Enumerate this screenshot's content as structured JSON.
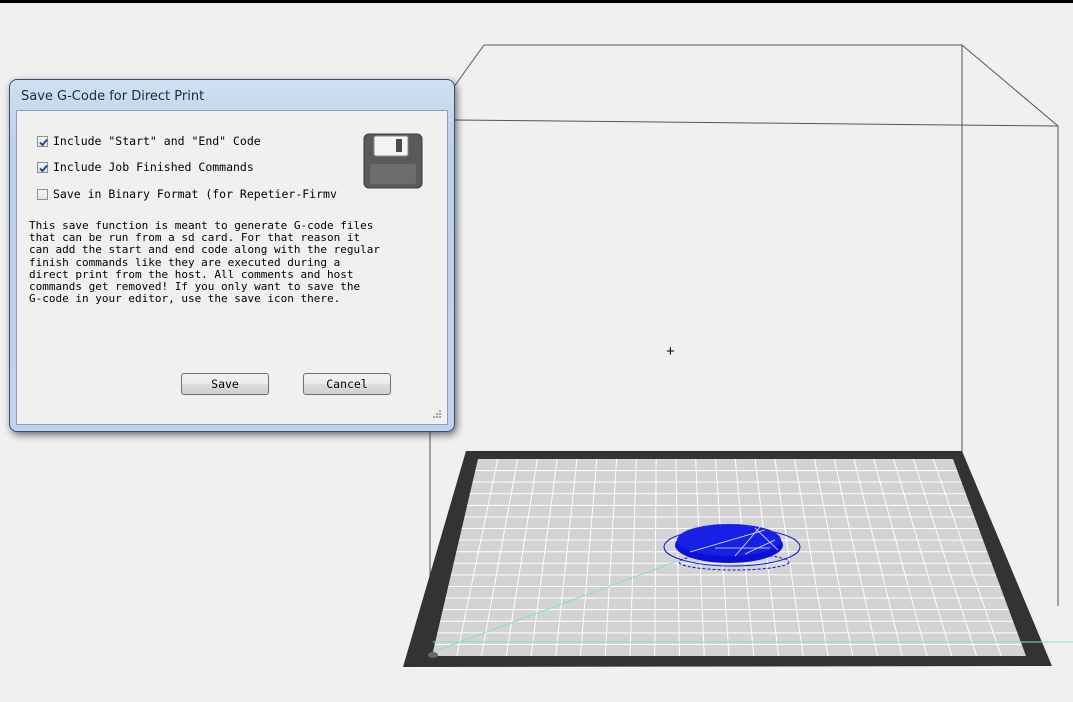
{
  "dialog": {
    "title": "Save G-Code for Direct Print",
    "options": [
      {
        "label": "Include \"Start\" and \"End\" Code",
        "checked": true
      },
      {
        "label": "Include Job Finished Commands",
        "checked": true
      },
      {
        "label": "Save in Binary Format (for Repetier-Firmv",
        "checked": false
      }
    ],
    "description": "This save function is meant to generate G-code files\nthat can be run from a sd card. For that reason it\ncan add the start and end code along with the regular\nfinish commands like they are executed during a\ndirect print from the host. All comments and host\ncommands get removed! If you only want to save the\nG-code in your editor, use the save icon there.",
    "save_label": "Save",
    "cancel_label": "Cancel",
    "save_icon": "floppy-disk-icon"
  },
  "viewport": {
    "center_marker": "+",
    "bed_color": "#333333",
    "grid_color": "#d2d2d2",
    "object_color": "#0a10d8",
    "x_axis_color": "#7fe0d0"
  }
}
